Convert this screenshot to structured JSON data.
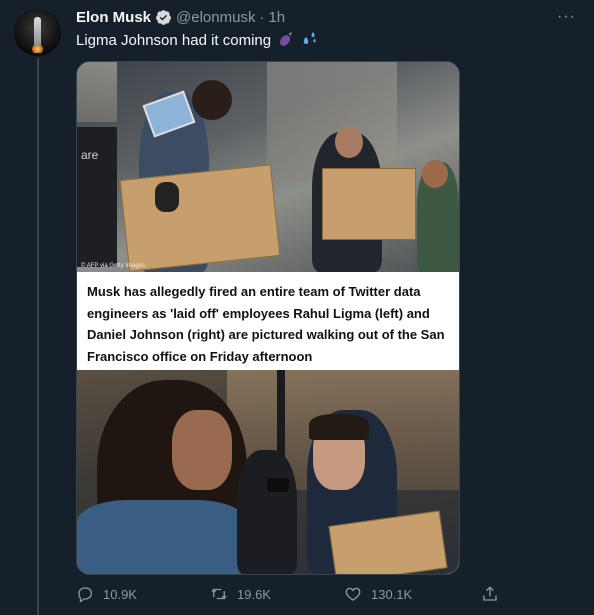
{
  "tweet": {
    "author_name": "Elon Musk",
    "handle": "@elonmusk",
    "separator": "·",
    "time": "1h",
    "text": "Ligma Johnson had it coming",
    "emojis": [
      "eggplant-emoji",
      "sweat-droplets-emoji"
    ]
  },
  "media": {
    "credit": "© AFP via Getty Images",
    "caption": "Musk has allegedly fired an entire team of Twitter data engineers as 'laid off' employees Rahul Ligma (left) and Daniel Johnson (right) are pictured walking out of the San Francisco office on Friday afternoon",
    "storefront_text": "are"
  },
  "stats": {
    "replies": "10.9K",
    "retweets": "19.6K",
    "likes": "130.1K"
  },
  "colors": {
    "background": "#15202b",
    "text_primary": "#f7f9f9",
    "text_secondary": "#8b98a5",
    "verified": "#1d9bf0",
    "border": "#38444d"
  },
  "icons": {
    "verified": "verified-badge-icon",
    "more": "more-icon",
    "reply": "reply-icon",
    "retweet": "retweet-icon",
    "like": "heart-icon",
    "share": "share-icon"
  }
}
